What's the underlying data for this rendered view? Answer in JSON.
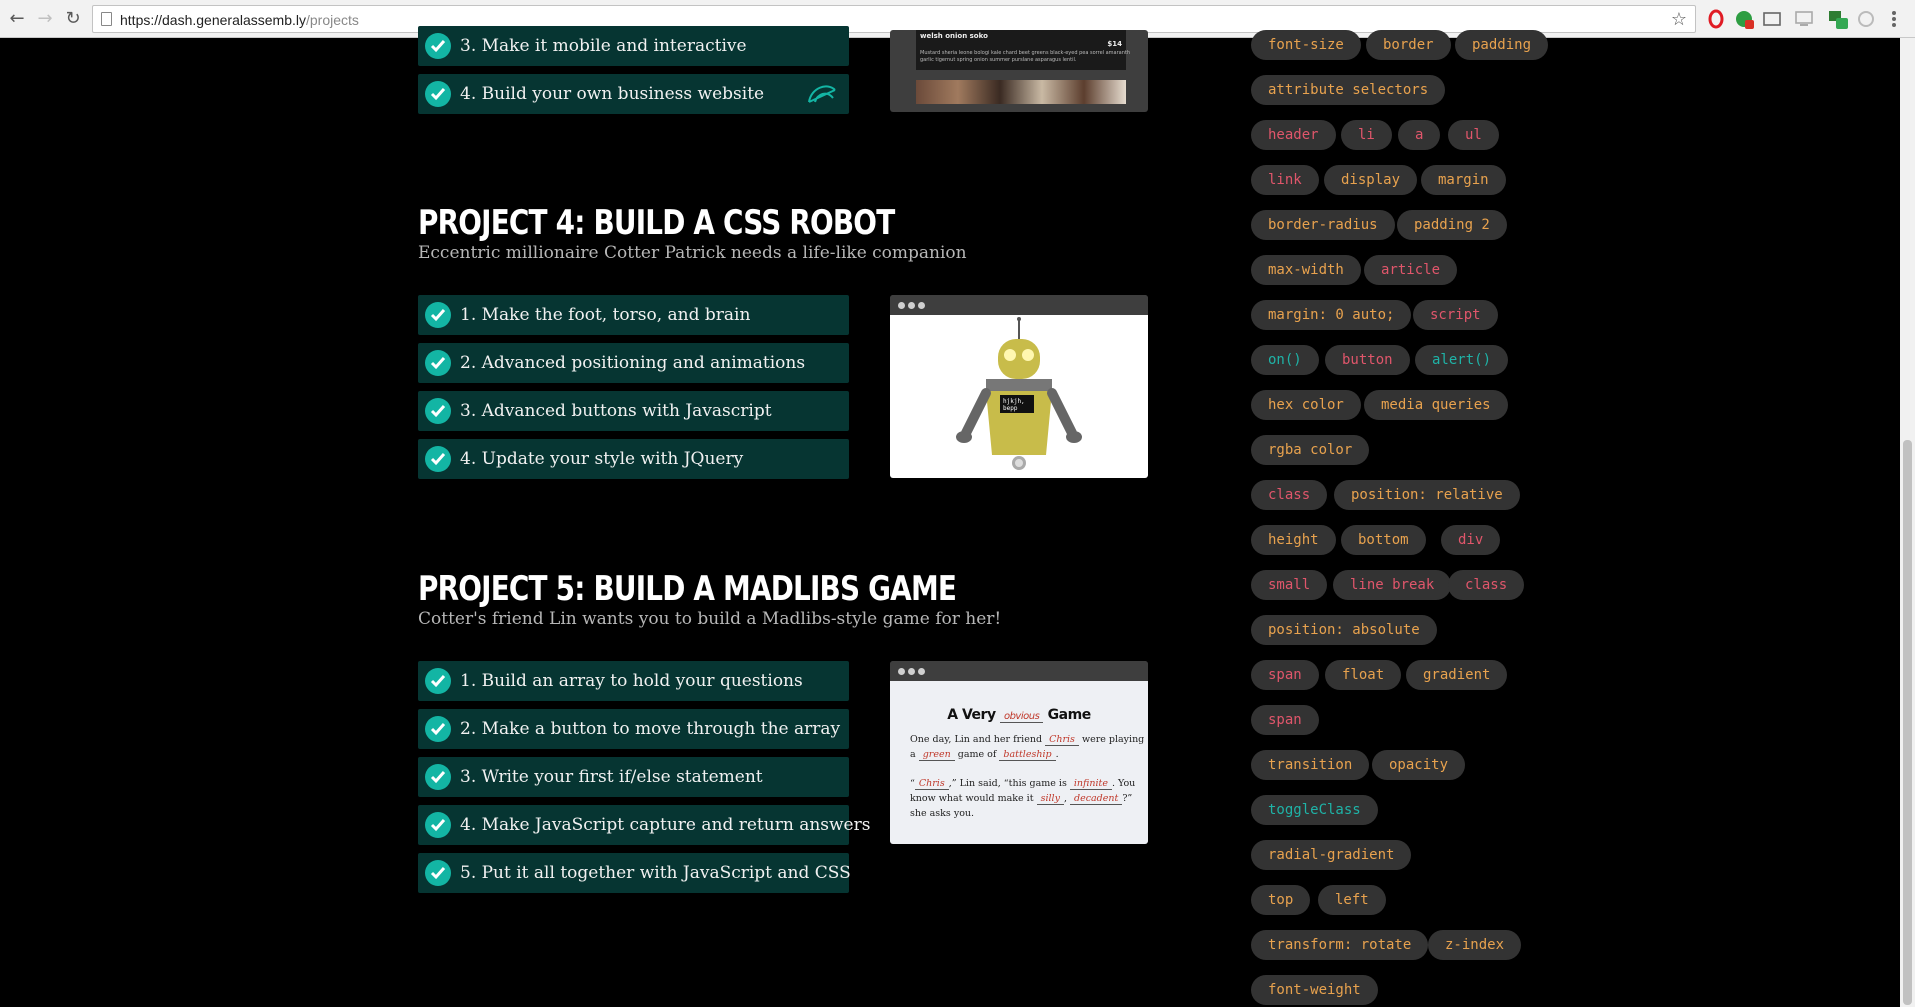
{
  "browser": {
    "url_host": "https://dash.generalassemb.ly",
    "url_path": "/projects"
  },
  "projects": {
    "p3_tasks": [
      {
        "label": "3. Make it mobile and interactive"
      },
      {
        "label": "4. Build your own business website"
      }
    ],
    "p3_preview_text": {
      "dish": "welsh onion soko",
      "price": "$14",
      "desc1": "Mustard sheria leone bologi kale chard beet greens black-eyed pea sorrel amaranth",
      "desc2": "garlic tigernut spring onion summer purslane asparagus lentil."
    },
    "p4": {
      "title": "PROJECT 4: BUILD A CSS ROBOT",
      "subtitle": "Eccentric millionaire Cotter Patrick needs a life-like companion",
      "tasks": [
        {
          "label": "1. Make the foot, torso, and brain"
        },
        {
          "label": "2. Advanced positioning and animations"
        },
        {
          "label": "3. Advanced buttons with Javascript"
        },
        {
          "label": "4. Update your style with JQuery"
        }
      ],
      "robot_screen_text": "hjkjh,\nbepp"
    },
    "p5": {
      "title": "PROJECT 5: BUILD A MADLIBS GAME",
      "subtitle": "Cotter's friend Lin wants you to build a Madlibs-style game for her!",
      "tasks": [
        {
          "label": "1. Build an array to hold your questions"
        },
        {
          "label": "2. Make a button to move through the array"
        },
        {
          "label": "3. Write your first if/else statement"
        },
        {
          "label": "4. Make JavaScript capture and return answers"
        },
        {
          "label": "5. Put it all together with JavaScript and CSS"
        }
      ],
      "madlib": {
        "title_a": "A Very",
        "title_fill": "obvious",
        "title_b": "Game",
        "l1a": "One day, Lin and her friend",
        "l1fill": "Chris",
        "l1b": "were playing",
        "l2a": "a",
        "l2fill": "green",
        "l2b": "game of",
        "l2fill2": "battleship",
        "l3q": "“",
        "l3fill": "Chris",
        "l3a": ",” Lin said, “this game is",
        "l3fill2": "infinite",
        "l3b": ". You",
        "l4a": "know what would make it",
        "l4fill": "silly",
        "l4fill2": "decadent",
        "l4b": "?”",
        "l5": "she asks you."
      }
    }
  },
  "tags": [
    {
      "label": "font-size",
      "color": "orange"
    },
    {
      "label": "border",
      "color": "orange"
    },
    {
      "label": "padding",
      "color": "orange"
    },
    {
      "label": "attribute selectors",
      "color": "orange"
    },
    {
      "label": "header",
      "color": "pink"
    },
    {
      "label": "li",
      "color": "pink"
    },
    {
      "label": "a",
      "color": "pink"
    },
    {
      "label": "ul",
      "color": "pink"
    },
    {
      "label": "link",
      "color": "pink"
    },
    {
      "label": "display",
      "color": "orange"
    },
    {
      "label": "margin",
      "color": "orange"
    },
    {
      "label": "border-radius",
      "color": "orange"
    },
    {
      "label": "padding 2",
      "color": "orange"
    },
    {
      "label": "max-width",
      "color": "orange"
    },
    {
      "label": "article",
      "color": "pink"
    },
    {
      "label": "margin: 0 auto;",
      "color": "orange"
    },
    {
      "label": "script",
      "color": "pink"
    },
    {
      "label": "on()",
      "color": "teal"
    },
    {
      "label": "button",
      "color": "pink"
    },
    {
      "label": "alert()",
      "color": "teal"
    },
    {
      "label": "hex color",
      "color": "orange"
    },
    {
      "label": "media queries",
      "color": "orange"
    },
    {
      "label": "rgba color",
      "color": "orange"
    },
    {
      "label": "class",
      "color": "pink"
    },
    {
      "label": "position: relative",
      "color": "orange"
    },
    {
      "label": "height",
      "color": "orange"
    },
    {
      "label": "bottom",
      "color": "orange"
    },
    {
      "label": "div",
      "color": "pink"
    },
    {
      "label": "small",
      "color": "pink"
    },
    {
      "label": "line break",
      "color": "pink"
    },
    {
      "label": "class",
      "color": "pink"
    },
    {
      "label": "position: absolute",
      "color": "orange"
    },
    {
      "label": "span",
      "color": "pink"
    },
    {
      "label": "float",
      "color": "orange"
    },
    {
      "label": "gradient",
      "color": "orange"
    },
    {
      "label": "span",
      "color": "pink"
    },
    {
      "label": "transition",
      "color": "orange"
    },
    {
      "label": "opacity",
      "color": "orange"
    },
    {
      "label": "toggleClass",
      "color": "teal"
    },
    {
      "label": "radial-gradient",
      "color": "orange"
    },
    {
      "label": "top",
      "color": "orange"
    },
    {
      "label": "left",
      "color": "orange"
    },
    {
      "label": "transform: rotate",
      "color": "orange"
    },
    {
      "label": "z-index",
      "color": "orange"
    },
    {
      "label": "font-weight",
      "color": "orange"
    }
  ],
  "colors": {
    "task_bg": "#063532",
    "check": "#13b5a4",
    "tag_orange": "#e8a24e",
    "tag_pink": "#e0566b",
    "tag_teal": "#1fb3a7"
  }
}
